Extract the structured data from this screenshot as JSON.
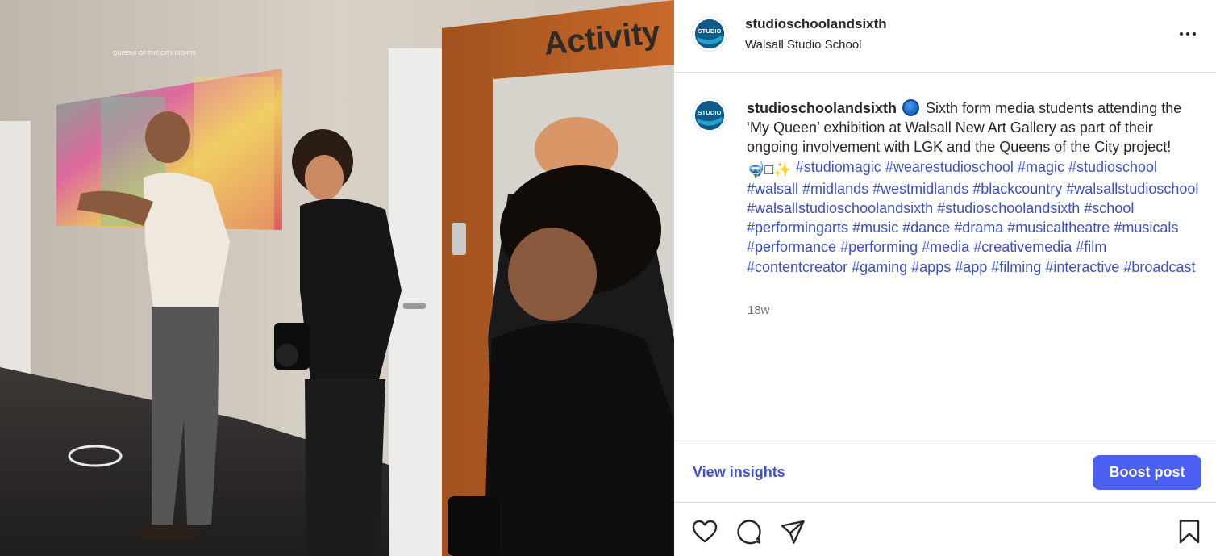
{
  "post": {
    "username": "studioschoolandsixth",
    "location": "Walsall Studio School",
    "avatar_logo_text": "STUDIO",
    "photo": {
      "projected_title": "QUEENS OF THE CITY DISHES",
      "door_sign": "Activity"
    },
    "caption": {
      "username": "studioschoolandsixth",
      "text_1": "Sixth form media students attending the ‘My Queen’ exhibition at Walsall New Art Gallery as part of their ongoing involvement with LGK and the Queens of the City project!",
      "emoji_1": "🤿",
      "emoji_2": "□",
      "emoji_3": "✨",
      "hashtags": [
        "#studiomagic",
        "#wearestudioschool",
        "#magic",
        "#studioschool",
        "#walsall",
        "#midlands",
        "#westmidlands",
        "#blackcountry",
        "#walsallstudioschool",
        "#walsallstudioschoolandsixth",
        "#studioschoolandsixth",
        "#school",
        "#performingarts",
        "#music",
        "#dance",
        "#drama",
        "#musicaltheatre",
        "#musicals",
        "#performance",
        "#performing",
        "#media",
        "#creativemedia",
        "#film",
        "#contentcreator",
        "#gaming",
        "#apps",
        "#app",
        "#filming",
        "#interactive",
        "#broadcast"
      ]
    },
    "timestamp": "18w",
    "view_insights_label": "View insights",
    "boost_label": "Boost post",
    "icons": {
      "more": "more-options-icon",
      "like": "heart-icon",
      "comment": "comment-icon",
      "share": "share-icon",
      "save": "bookmark-icon"
    },
    "colors": {
      "link": "#3a4fc5",
      "boost_button": "#4a5ff2",
      "view_insights": "#3f51c9",
      "muted_text": "#737373"
    }
  }
}
